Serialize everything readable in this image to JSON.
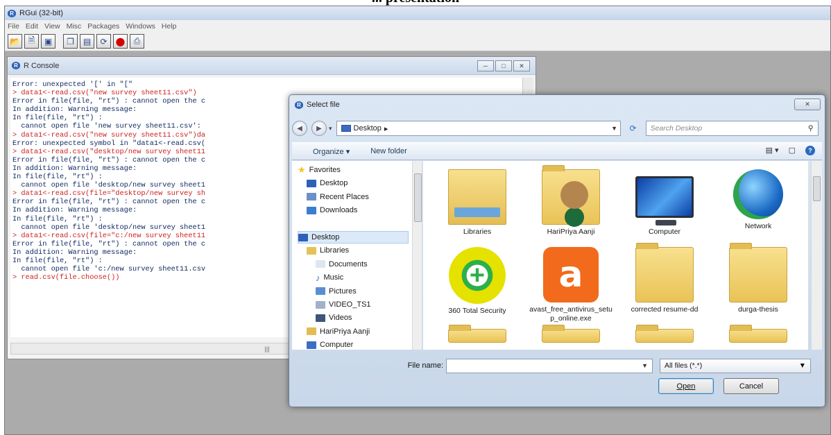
{
  "caption": "... presentation",
  "app": {
    "title": "RGui (32-bit)",
    "menu": [
      "File",
      "Edit",
      "View",
      "Misc",
      "Packages",
      "Windows",
      "Help"
    ],
    "toolbar": [
      "open-script-icon",
      "load-workspace-icon",
      "save-icon",
      "copy-icon",
      "paste-icon",
      "refresh-icon",
      "stop-icon",
      "print-icon"
    ]
  },
  "console": {
    "title": "R Console",
    "lines": [
      {
        "text": "Error: unexpected '[' in \"[\"",
        "kind": "out"
      },
      {
        "text": "> data1<-read.csv(\"new survey sheet11.csv\")",
        "kind": "in"
      },
      {
        "text": "Error in file(file, \"rt\") : cannot open the c",
        "kind": "out"
      },
      {
        "text": "In addition: Warning message:",
        "kind": "out"
      },
      {
        "text": "In file(file, \"rt\") :",
        "kind": "out"
      },
      {
        "text": "  cannot open file 'new survey sheet11.csv':",
        "kind": "out"
      },
      {
        "text": "> data1<-read.csv(\"new survey sheet11.csv\")da",
        "kind": "in"
      },
      {
        "text": "Error: unexpected symbol in \"data1<-read.csv(",
        "kind": "out"
      },
      {
        "text": "> data1<-read.csv(\"desktop/new survey sheet11",
        "kind": "in"
      },
      {
        "text": "Error in file(file, \"rt\") : cannot open the c",
        "kind": "out"
      },
      {
        "text": "In addition: Warning message:",
        "kind": "out"
      },
      {
        "text": "In file(file, \"rt\") :",
        "kind": "out"
      },
      {
        "text": "  cannot open file 'desktop/new survey sheet1",
        "kind": "out"
      },
      {
        "text": "> data1<-read.csv(file=\"desktop/new survey sh",
        "kind": "in"
      },
      {
        "text": "Error in file(file, \"rt\") : cannot open the c",
        "kind": "out"
      },
      {
        "text": "In addition: Warning message:",
        "kind": "out"
      },
      {
        "text": "In file(file, \"rt\") :",
        "kind": "out"
      },
      {
        "text": "  cannot open file 'desktop/new survey sheet1",
        "kind": "out"
      },
      {
        "text": "> data1<-read.csv(file=\"c:/new survey sheet11",
        "kind": "in"
      },
      {
        "text": "Error in file(file, \"rt\") : cannot open the c",
        "kind": "out"
      },
      {
        "text": "In addition: Warning message:",
        "kind": "out"
      },
      {
        "text": "In file(file, \"rt\") :",
        "kind": "out"
      },
      {
        "text": "  cannot open file 'c:/new survey sheet11.csv",
        "kind": "out"
      },
      {
        "text": "> read.csv(file.choose())",
        "kind": "in"
      }
    ]
  },
  "dialog": {
    "title": "Select file",
    "address": "Desktop",
    "search_placeholder": "Search Desktop",
    "organize": "Organize ▾",
    "new_folder": "New folder",
    "nav": [
      {
        "label": "Favorites",
        "icon": "star-icon",
        "indent": 0
      },
      {
        "label": "Desktop",
        "icon": "desktop-icon",
        "indent": 1
      },
      {
        "label": "Recent Places",
        "icon": "recent-places-icon",
        "indent": 1
      },
      {
        "label": "Downloads",
        "icon": "downloads-icon",
        "indent": 1
      },
      {
        "label": "",
        "icon": "",
        "indent": 0
      },
      {
        "label": "Desktop",
        "icon": "desktop-icon",
        "indent": 0,
        "selected": true
      },
      {
        "label": "Libraries",
        "icon": "libraries-icon",
        "indent": 1
      },
      {
        "label": "Documents",
        "icon": "documents-icon",
        "indent": 2
      },
      {
        "label": "Music",
        "icon": "music-icon",
        "indent": 2
      },
      {
        "label": "Pictures",
        "icon": "pictures-icon",
        "indent": 2
      },
      {
        "label": "VIDEO_TS1",
        "icon": "video-folder-icon",
        "indent": 2
      },
      {
        "label": "Videos",
        "icon": "videos-icon",
        "indent": 2
      },
      {
        "label": "HariPriya Aanji",
        "icon": "user-folder-icon",
        "indent": 1
      },
      {
        "label": "Computer",
        "icon": "computer-icon",
        "indent": 1
      }
    ],
    "files": [
      {
        "label": "Libraries",
        "icon": "libraries-icon"
      },
      {
        "label": "HariPriya Aanji",
        "icon": "user-folder-icon"
      },
      {
        "label": "Computer",
        "icon": "computer-icon"
      },
      {
        "label": "Network",
        "icon": "network-icon"
      },
      {
        "label": "360 Total Security",
        "icon": "360-security-icon"
      },
      {
        "label": "avast_free_antivirus_setup_online.exe",
        "icon": "avast-installer-icon"
      },
      {
        "label": "corrected resume-dd",
        "icon": "folder-icon"
      },
      {
        "label": "durga-thesis",
        "icon": "folder-icon"
      },
      {
        "label": "",
        "icon": "folder-icon"
      },
      {
        "label": "",
        "icon": "folder-icon"
      },
      {
        "label": "",
        "icon": "folder-icon"
      },
      {
        "label": "",
        "icon": "folder-icon"
      }
    ],
    "file_name_label": "File name:",
    "file_name_value": "",
    "filter": "All files (*.*)",
    "open": "Open",
    "cancel": "Cancel"
  },
  "colors": {
    "console_input": "#cc1f1f",
    "console_output": "#102a60",
    "selection": "#dbe9f8"
  }
}
